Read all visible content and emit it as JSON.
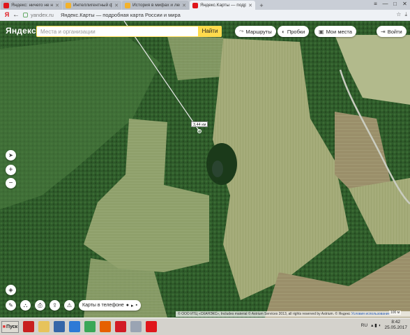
{
  "browser": {
    "tabs": [
      {
        "title": "Яндекс: ничего не найде",
        "favicon_color": "#e0161b"
      },
      {
        "title": "Интеллигентный форум. Те",
        "favicon_color": "#f3b22c"
      },
      {
        "title": "История в мифах и легенд",
        "favicon_color": "#f3b22c"
      },
      {
        "title": "Яндекс.Карты — подробна",
        "favicon_color": "#e0161b"
      }
    ],
    "new_tab": "+",
    "window_controls": [
      "≡",
      "—",
      "□",
      "✕"
    ],
    "ya_button": "Я",
    "back": "←",
    "url_host": "yandex.ru",
    "page_title": "Яндекс.Карты — подробная карта России и мира",
    "addr_right_icons": [
      "☆",
      "⤓"
    ]
  },
  "yandex": {
    "logo": "Яндекс",
    "search_placeholder": "Места и организации",
    "find_button": "Найти",
    "routes": "Маршруты",
    "traffic": "Пробки",
    "my_places": "Мои места",
    "login": "Войти"
  },
  "map": {
    "measure_label": "3,44 км",
    "controls": {
      "plus": "+",
      "minus": "−"
    },
    "phone_button": "Карты в телефоне",
    "copyright": "© ООО ИТЦ «СКАНЭКС», Includes material © Astrium Services 2013, all rights reserved by Astrium. © Яндекс",
    "conditions": "Условия использования",
    "scale": "100 м"
  },
  "taskbar": {
    "start": "Пуск",
    "icons": [
      {
        "name": "acrobat-icon",
        "color": "#c8201f"
      },
      {
        "name": "folder-icon",
        "color": "#e7c35b"
      },
      {
        "name": "player-icon",
        "color": "#3566a8"
      },
      {
        "name": "ie-icon",
        "color": "#2d7ad6"
      },
      {
        "name": "chrome-icon",
        "color": "#3aa757"
      },
      {
        "name": "firefox-icon",
        "color": "#e66000"
      },
      {
        "name": "opera-icon",
        "color": "#d21b24"
      },
      {
        "name": "document-icon",
        "color": "#9aa4b3"
      },
      {
        "name": "yandex-browser-icon",
        "color": "#e0161b"
      }
    ],
    "lang": "RU",
    "time": "8:42",
    "date": "25.05.2017"
  }
}
